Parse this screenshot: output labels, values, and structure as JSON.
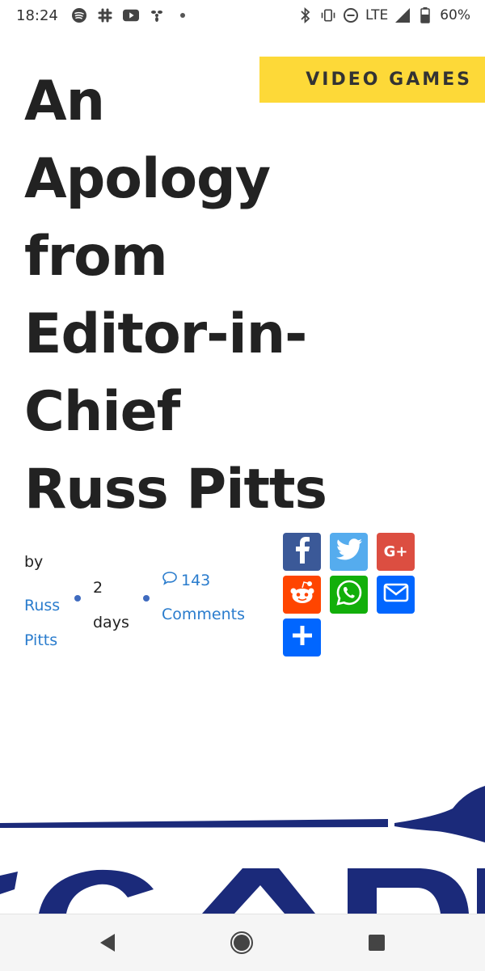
{
  "status_bar": {
    "time": "18:24",
    "left_icons": [
      "spotify-icon",
      "slack-icon",
      "youtube-icon",
      "fan-icon",
      "dot-icon"
    ],
    "right_icons": [
      "bluetooth-icon",
      "vibrate-icon",
      "do-not-disturb-icon",
      "signal-icon",
      "battery-icon"
    ],
    "network": "LTE",
    "battery": "60%"
  },
  "article": {
    "category": "VIDEO GAMES",
    "title_lines": [
      "An",
      "Apology",
      "from",
      "Editor-in-",
      "Chief",
      "Russ Pitts"
    ],
    "byline_label": "by",
    "author_lines": [
      "Russ",
      "Pitts"
    ],
    "time_ago_lines": [
      "2",
      "days"
    ],
    "comment_count": "143",
    "comments_label": "Comments"
  },
  "share": {
    "buttons": [
      {
        "name": "facebook",
        "icon": "facebook-icon",
        "color": "#3b5998"
      },
      {
        "name": "twitter",
        "icon": "twitter-icon",
        "color": "#55acee"
      },
      {
        "name": "google-plus",
        "icon": "google-plus-icon",
        "color": "#dc4e41"
      },
      {
        "name": "reddit",
        "icon": "reddit-icon",
        "color": "#ff4500"
      },
      {
        "name": "whatsapp",
        "icon": "whatsapp-icon",
        "color": "#12af0a"
      },
      {
        "name": "email",
        "icon": "email-icon",
        "color": "#0166ff"
      },
      {
        "name": "more",
        "icon": "plus-icon",
        "color": "#0166ff"
      }
    ],
    "google_plus_label": "G+"
  },
  "colors": {
    "category_bg": "#fdd938",
    "link": "#2a7ccd",
    "logo": "#1b2a7a"
  }
}
